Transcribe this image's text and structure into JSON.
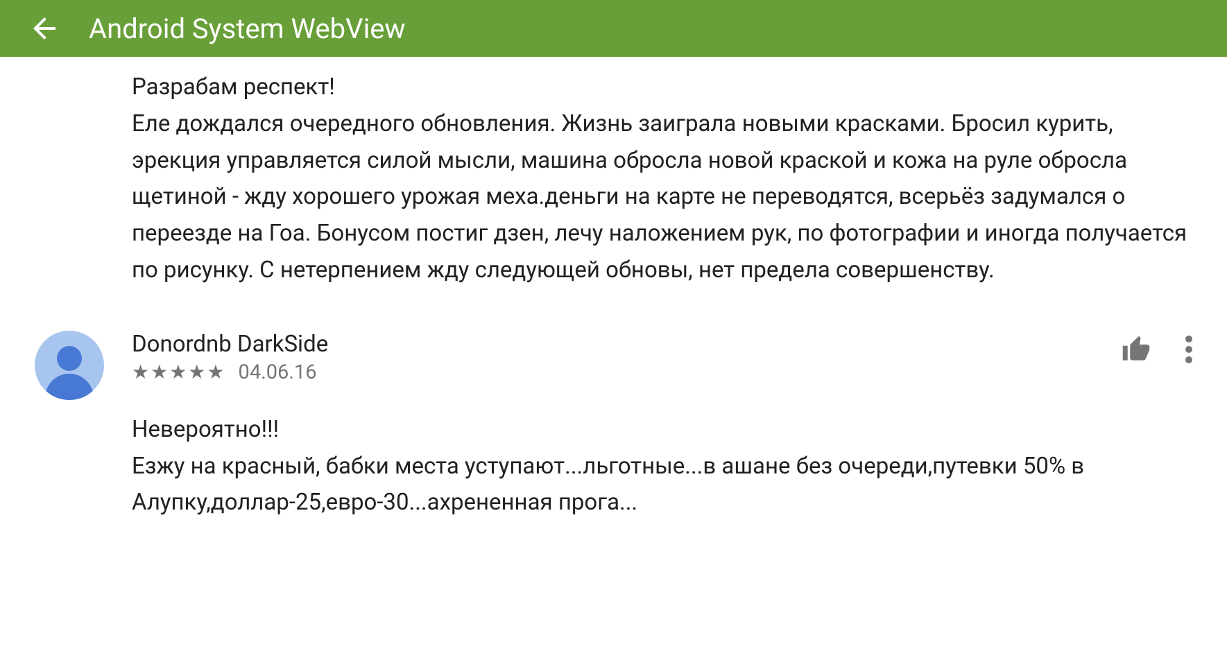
{
  "header": {
    "title": "Android System WebView"
  },
  "reviews": [
    {
      "title": "Разрабам респект!",
      "body": "Еле дождался очередного обновления. Жизнь заиграла новыми красками. Бросил курить, эрекция управляется силой мысли, машина обросла новой краской и кожа на руле обросла щетиной - жду хорошего урожая меха.деньги на карте не переводятся, всерьёз задумался о переезде на Гоа. Бонусом постиг дзен, лечу наложением рук, по фотографии и иногда получается по рисунку. С нетерпением жду следующей обновы, нет предела совершенству."
    },
    {
      "author": "Donordnb DarkSide",
      "rating": 5,
      "date": "04.06.16",
      "title": "Невероятно!!!",
      "body": "Езжу на красный, бабки места уступают...льготные...в ашане без очереди,путевки 50% в Алупку,доллар-25,евро-30...ахрененная прога..."
    }
  ]
}
